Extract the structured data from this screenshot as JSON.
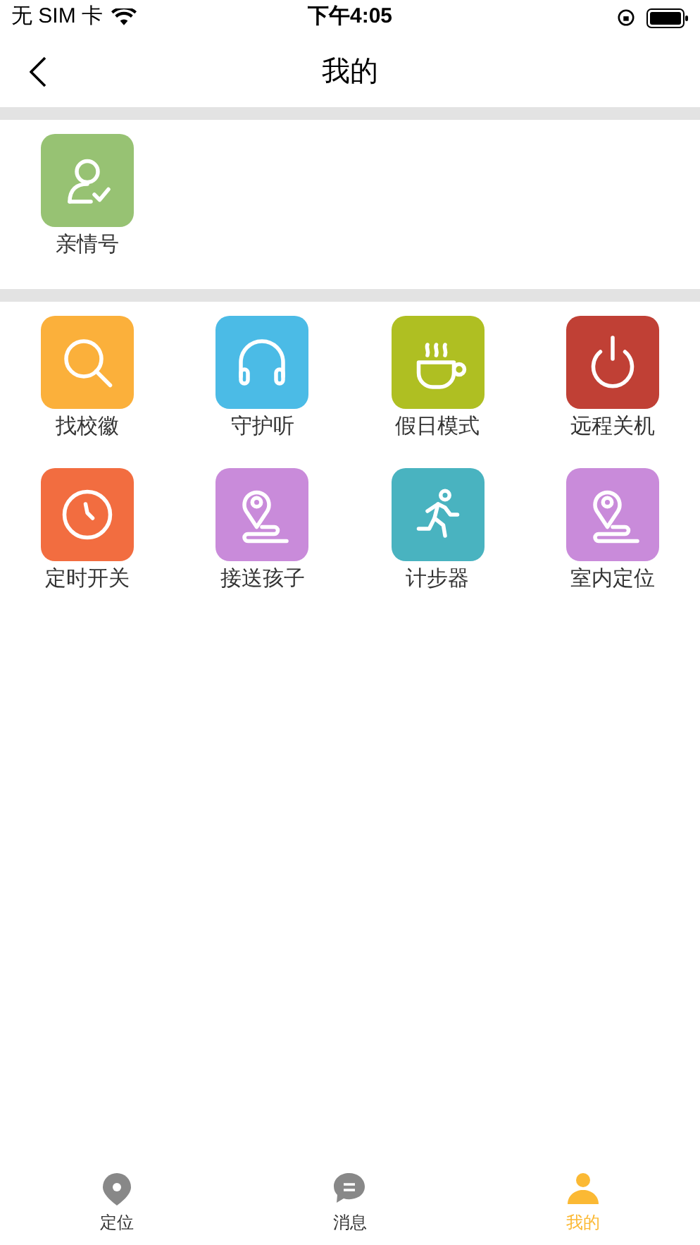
{
  "status_bar": {
    "carrier": "无 SIM 卡",
    "time": "下午4:05"
  },
  "nav": {
    "title": "我的"
  },
  "sections": [
    {
      "items": [
        {
          "label": "亲情号",
          "kind": "contact",
          "color": "#97c273"
        }
      ]
    },
    {
      "items": [
        {
          "label": "找校徽",
          "kind": "search",
          "color": "#fbb03b"
        },
        {
          "label": "守护听",
          "kind": "headphones",
          "color": "#4bbbe6"
        },
        {
          "label": "假日模式",
          "kind": "cup",
          "color": "#afbf22"
        },
        {
          "label": "远程关机",
          "kind": "power",
          "color": "#c04035"
        },
        {
          "label": "定时开关",
          "kind": "clock",
          "color": "#f26d40"
        },
        {
          "label": "接送孩子",
          "kind": "route",
          "color": "#c98bda"
        },
        {
          "label": "计步器",
          "kind": "runner",
          "color": "#49b3c0"
        },
        {
          "label": "室内定位",
          "kind": "route",
          "color": "#c98bda"
        }
      ]
    }
  ],
  "tab_bar": [
    {
      "label": "定位",
      "kind": "pin",
      "selected": false
    },
    {
      "label": "消息",
      "kind": "chat",
      "selected": false
    },
    {
      "label": "我的",
      "kind": "person",
      "selected": true
    }
  ]
}
